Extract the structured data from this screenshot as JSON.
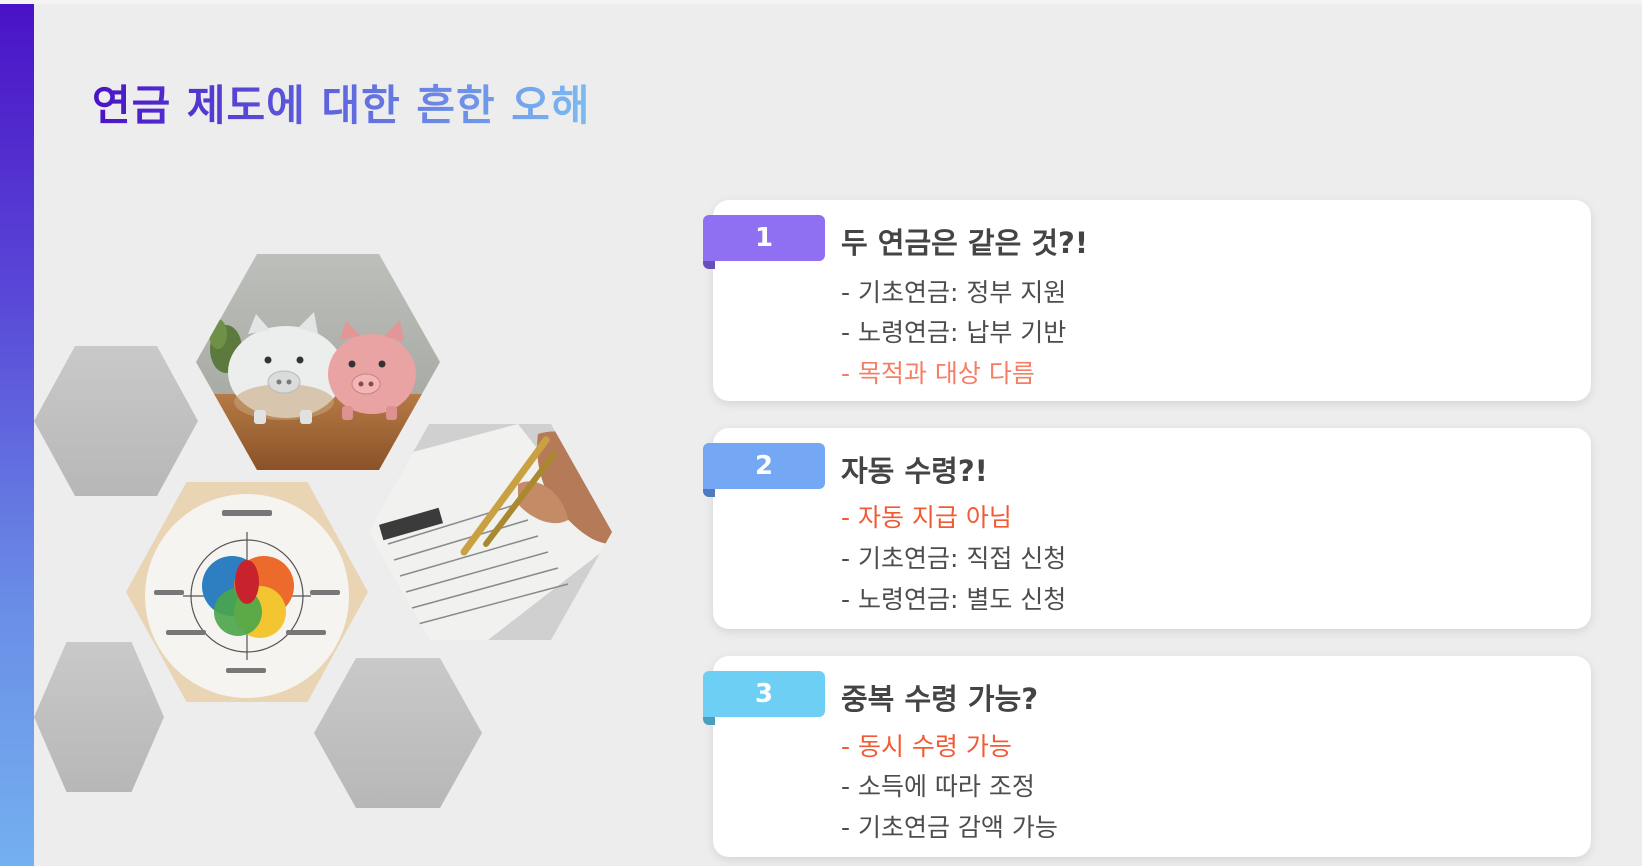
{
  "slide": {
    "title": "연금 제도에 대한 흔한 오해",
    "colors": {
      "accent_top": "#4a12c6",
      "accent_bottom": "#74b0f0",
      "highlight": "#f15a35",
      "tab1": "#8f6ff2",
      "tab2": "#74a7f4",
      "tab3": "#6ecff4"
    },
    "images": [
      {
        "icon": "piggy-banks-photo"
      },
      {
        "icon": "pension-form-signing-photo"
      },
      {
        "icon": "pension-diagram-photo"
      }
    ],
    "cards": [
      {
        "number": "1",
        "title": "두 연금은 같은 것?!",
        "items": [
          "- 기초연금: 정부 지원",
          "- 노령연금: 납부 기반",
          "- 목적과 대상 다름"
        ]
      },
      {
        "number": "2",
        "title": "자동 수령?!",
        "items": [
          "- 자동 지급 아님",
          "- 기초연금: 직접 신청",
          "- 노령연금: 별도 신청"
        ]
      },
      {
        "number": "3",
        "title": "중복 수령 가능?",
        "items": [
          "- 동시 수령 가능",
          "- 소득에 따라 조정",
          "- 기초연금 감액 가능"
        ]
      }
    ]
  }
}
